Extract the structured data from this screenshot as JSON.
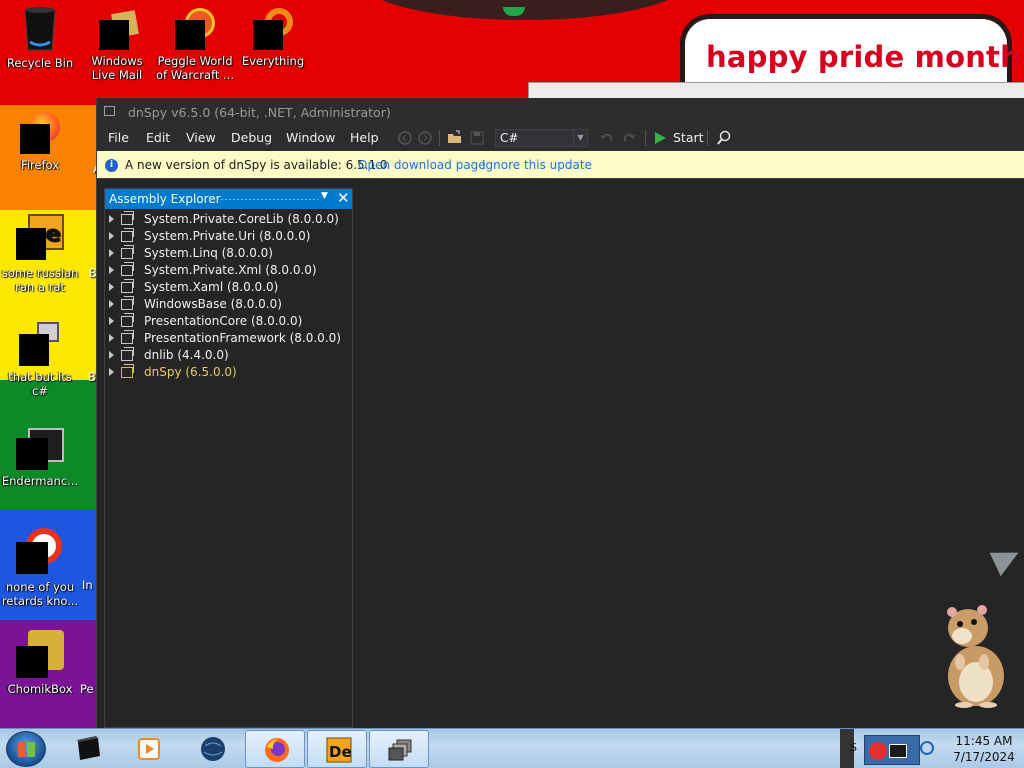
{
  "desktop": {
    "banner_text": "happy pride month",
    "icons": [
      {
        "label": "Recycle Bin",
        "icon": "recycle-bin-icon"
      },
      {
        "label": "Windows Live Mail",
        "icon": "windows-live-mail-icon"
      },
      {
        "label": "Peggle World of Warcraft ...",
        "icon": "peggle-icon"
      },
      {
        "label": "Everything",
        "icon": "everything-search-icon"
      },
      {
        "label": "Firefox",
        "icon": "firefox-icon"
      },
      {
        "label": "some russian ran a rat",
        "icon": "dnspy-shortcut-icon"
      },
      {
        "label": "that but its c#",
        "icon": "stacked-windows-icon"
      },
      {
        "label": "Endermanc...",
        "icon": "terminal-icon"
      },
      {
        "label": "none of you retards kno...",
        "icon": "opera-icon"
      },
      {
        "label": "ChomikBox",
        "icon": "chomikbox-icon"
      }
    ],
    "partial_labels": [
      "A",
      "B",
      "B",
      "In",
      "Pe"
    ]
  },
  "window": {
    "title": "dnSpy v6.5.0 (64-bit, .NET, Administrator)",
    "menu": [
      "File",
      "Edit",
      "View",
      "Debug",
      "Window",
      "Help"
    ],
    "language": "C#",
    "start_label": "Start",
    "notification": {
      "message": "A new version of dnSpy is available: 6.5.1.0",
      "open_link": "Open download page",
      "ignore_link": "Ignore this update"
    },
    "panel": {
      "title": "Assembly Explorer",
      "assemblies": [
        "System.Private.CoreLib (8.0.0.0)",
        "System.Private.Uri (8.0.0.0)",
        "System.Linq (8.0.0.0)",
        "System.Private.Xml (8.0.0.0)",
        "System.Xaml (8.0.0.0)",
        "WindowsBase (8.0.0.0)",
        "PresentationCore (8.0.0.0)",
        "PresentationFramework (8.0.0.0)",
        "dnlib (4.4.0.0)",
        "dnSpy (6.5.0.0)"
      ]
    }
  },
  "taskbar": {
    "apps": [
      "terminal-app-icon",
      "media-player-icon",
      "globe-icon",
      "firefox-icon",
      "dnspy-icon",
      "stacked-windows-icon"
    ],
    "time": "11:45 AM",
    "date": "7/17/2024"
  },
  "colors": {
    "accent": "#007acc",
    "banner_red": "#d8001f",
    "notify_bg": "#fdfbc6"
  }
}
